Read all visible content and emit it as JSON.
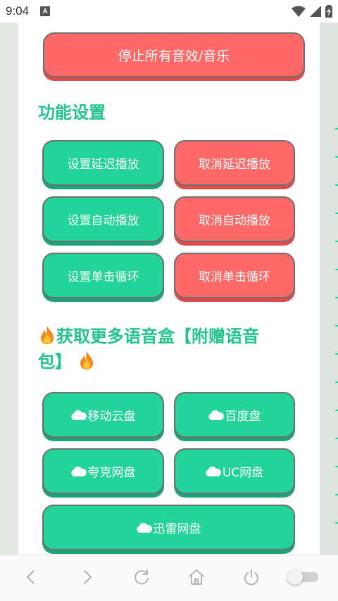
{
  "status": {
    "time": "9:04",
    "notif_letter": "A"
  },
  "stop_button": "停止所有音效/音乐",
  "feature_section": {
    "title": "功能设置",
    "buttons": [
      "设置延迟播放",
      "取消延迟播放",
      "设置自动播放",
      "取消自动播放",
      "设置单击循环",
      "取消单击循环"
    ]
  },
  "download_section": {
    "title_line1": "获取更多语音盒【附赠语音",
    "title_line2": "包】",
    "buttons": [
      "移动云盘",
      "百度盘",
      "夸克网盘",
      "UC网盘",
      "迅雷网盘"
    ]
  },
  "colors": {
    "green": "#22d39a",
    "red": "#fe6967",
    "title": "#22c48e"
  },
  "icons": [
    "back-icon",
    "forward-icon",
    "refresh-icon",
    "home-icon",
    "power-icon"
  ]
}
